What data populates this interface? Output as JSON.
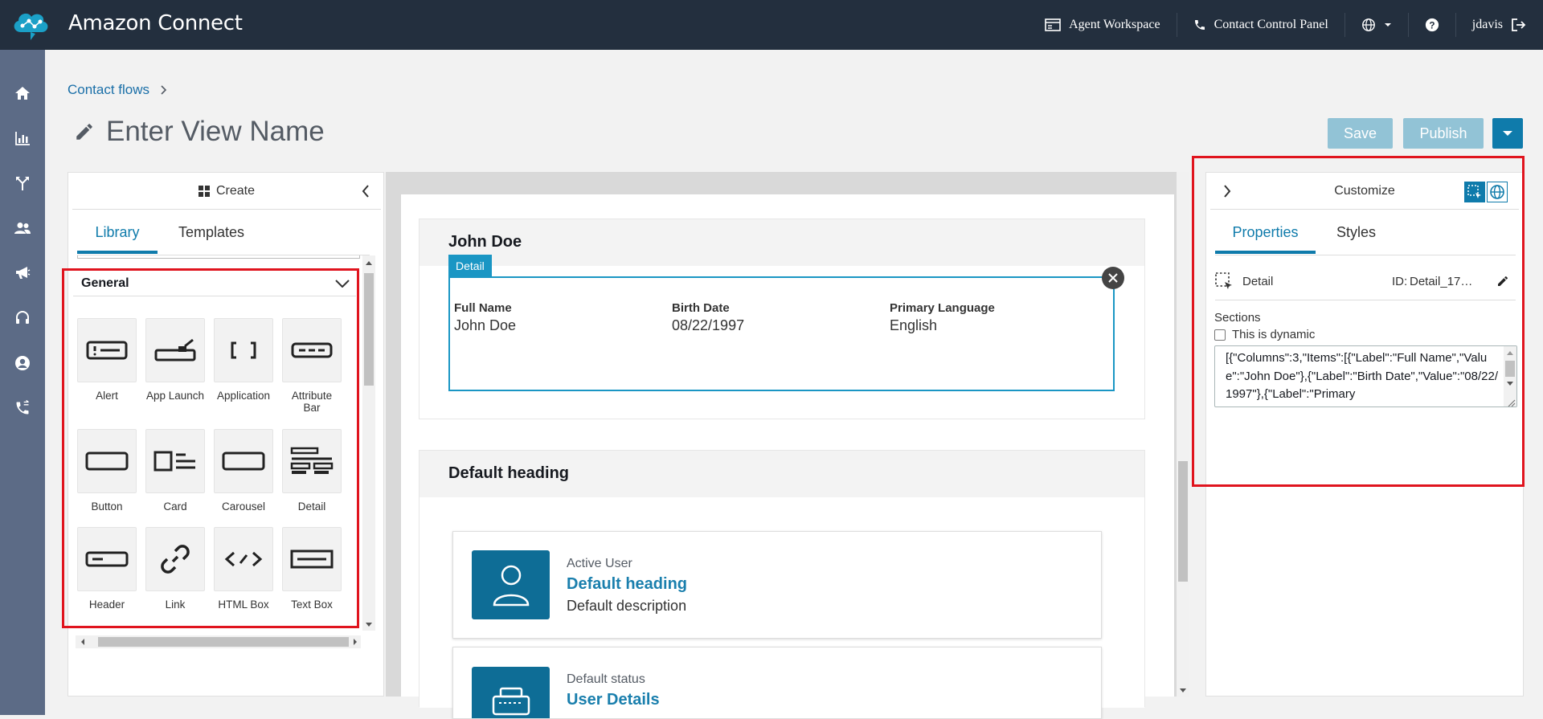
{
  "app": {
    "brand": "Amazon Connect"
  },
  "topnav": {
    "agent_workspace": "Agent Workspace",
    "ccp": "Contact Control Panel",
    "user": "jdavis"
  },
  "breadcrumb": {
    "root": "Contact flows"
  },
  "view": {
    "title": "Enter View Name"
  },
  "actions": {
    "save": "Save",
    "publish": "Publish"
  },
  "left_panel": {
    "title": "Create",
    "tabs": [
      "Library",
      "Templates"
    ],
    "group": "General",
    "components": [
      "Alert",
      "App Launch",
      "Application",
      "Attribute Bar",
      "Button",
      "Card",
      "Carousel",
      "Detail",
      "Header",
      "Link",
      "HTML Box",
      "Text Box"
    ]
  },
  "canvas": {
    "section1": {
      "heading": "John Doe",
      "detail_tag": "Detail",
      "fields": [
        {
          "label": "Full Name",
          "value": "John Doe"
        },
        {
          "label": "Birth Date",
          "value": "08/22/1997"
        },
        {
          "label": "Primary Language",
          "value": "English"
        }
      ]
    },
    "section2": {
      "heading": "Default heading",
      "card1": {
        "status": "Active User",
        "heading": "Default heading",
        "description": "Default description"
      },
      "card2": {
        "status": "Default status",
        "heading": "User Details"
      }
    }
  },
  "right_panel": {
    "title": "Customize",
    "tabs": [
      "Properties",
      "Styles"
    ],
    "component": "Detail",
    "id_label": "ID:",
    "id_value": "Detail_17…",
    "sections_label": "Sections",
    "dynamic_label": "This is dynamic",
    "dynamic_checked": false,
    "json_value": "[{\"Columns\":3,\"Items\":[{\"Label\":\"Full Name\",\"Value\":\"John Doe\"},{\"Label\":\"Birth Date\",\"Value\":\"08/22/1997\"},{\"Label\":\"Primary"
  },
  "colors": {
    "topbar": "#232f3e",
    "sidenav": "#5c6b86",
    "accent": "#0f7bab",
    "highlight": "#e0141e"
  }
}
